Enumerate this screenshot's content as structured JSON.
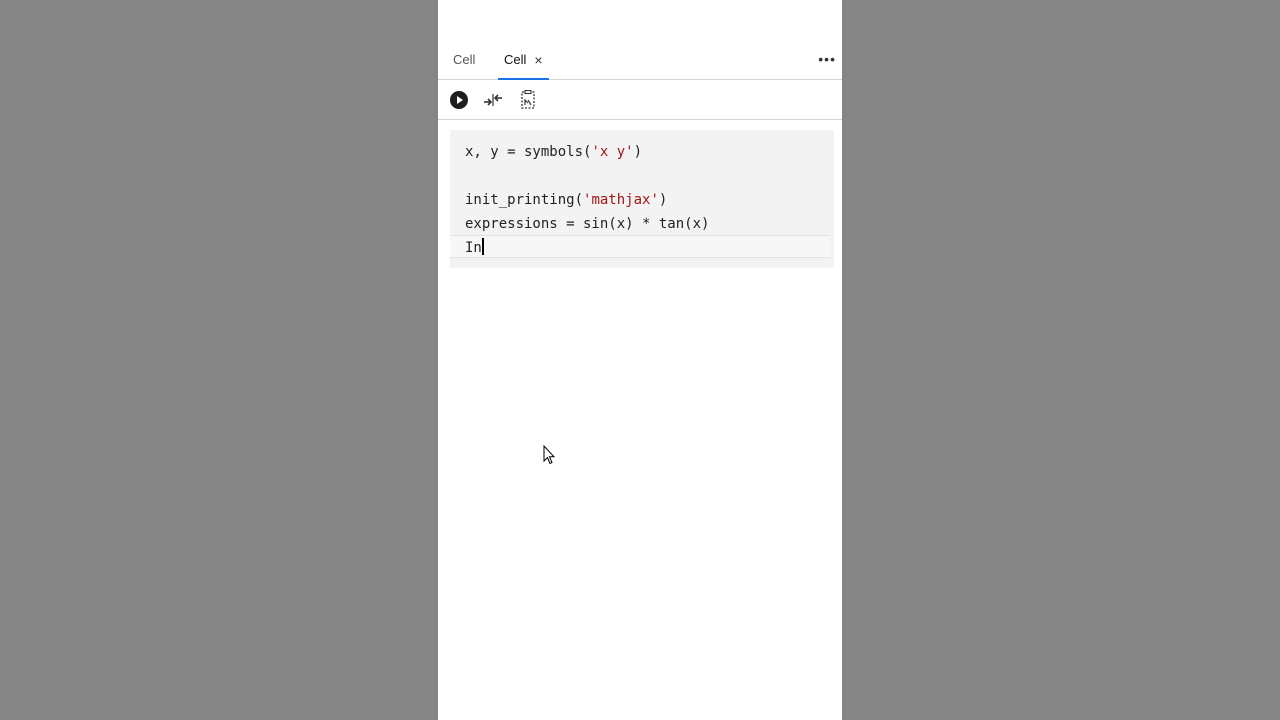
{
  "tabs": [
    {
      "label": "Cell",
      "active": false
    },
    {
      "label": "Cell",
      "active": true
    }
  ],
  "tab_close_glyph": "×",
  "more_glyph": "•••",
  "toolbar": {
    "icons": [
      "run-icon",
      "merge-icon",
      "copy-to-clipboard-icon"
    ]
  },
  "code": {
    "line1": "x, y = symbols(",
    "line1_str": "'x y'",
    "line1_end": ")",
    "line3": "init_printing(",
    "line3_str": "'mathjax'",
    "line3_end": ")",
    "line4": "expressions = sin(x) * tan(x)",
    "line5": "In"
  },
  "colors": {
    "background": "#858585",
    "panel": "#ffffff",
    "active_tab_underline": "#1a73e8",
    "string": "#a31515"
  }
}
